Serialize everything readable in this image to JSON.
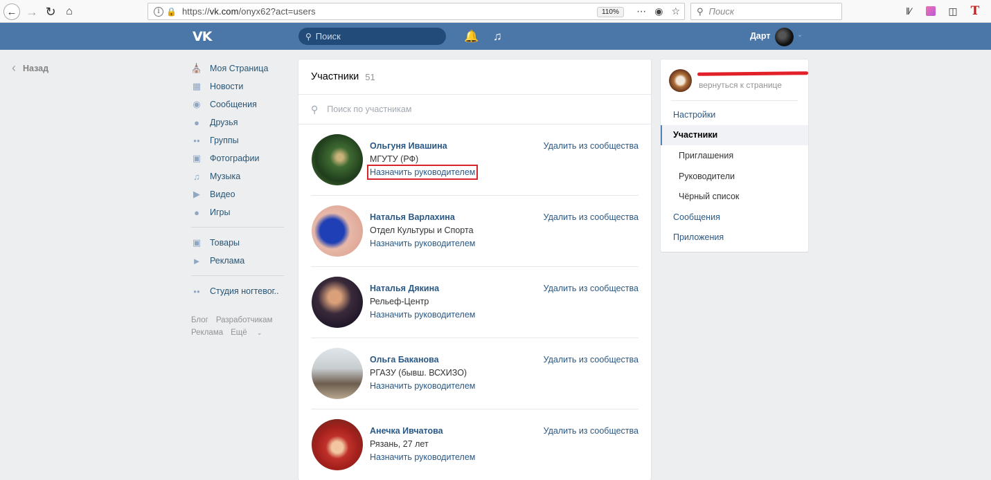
{
  "browser": {
    "url_prefix": "https://",
    "url_host": "vk.com",
    "url_path": "/onyx62?act=users",
    "zoom": "110%",
    "search_placeholder": "Поиск"
  },
  "header": {
    "search_placeholder": "Поиск",
    "user_name": "Дарт"
  },
  "back": {
    "label": "Назад"
  },
  "left_menu": {
    "items": [
      {
        "label": "Моя Страница",
        "icon": "home-icon"
      },
      {
        "label": "Новости",
        "icon": "news-icon"
      },
      {
        "label": "Сообщения",
        "icon": "messages-icon"
      },
      {
        "label": "Друзья",
        "icon": "friends-icon"
      },
      {
        "label": "Группы",
        "icon": "groups-icon"
      },
      {
        "label": "Фотографии",
        "icon": "photos-icon"
      },
      {
        "label": "Музыка",
        "icon": "music-icon"
      },
      {
        "label": "Видео",
        "icon": "video-icon"
      },
      {
        "label": "Игры",
        "icon": "games-icon"
      }
    ],
    "items2": [
      {
        "label": "Товары",
        "icon": "goods-icon"
      },
      {
        "label": "Реклама",
        "icon": "ads-icon"
      }
    ],
    "items3": [
      {
        "label": "Студия ногтевог..",
        "icon": "community-icon"
      }
    ],
    "footer": {
      "blog": "Блог",
      "dev": "Разработчикам",
      "ads": "Реклама",
      "more": "Ещё"
    }
  },
  "main": {
    "title": "Участники",
    "count": "51",
    "search_placeholder": "Поиск по участникам",
    "members": [
      {
        "name": "Ольгуня Ивашина",
        "info": "МГУТУ (РФ)",
        "promote": "Назначить руководителем",
        "remove": "Удалить из сообщества"
      },
      {
        "name": "Наталья Варлахина",
        "info": "Отдел Культуры и Спорта",
        "promote": "Назначить руководителем",
        "remove": "Удалить из сообщества"
      },
      {
        "name": "Наталья Дякина",
        "info": "Рельеф-Центр",
        "promote": "Назначить руководителем",
        "remove": "Удалить из сообщества"
      },
      {
        "name": "Ольга Баканова",
        "info": "РГАЗУ (бывш. ВСХИЗО)",
        "promote": "Назначить руководителем",
        "remove": "Удалить из сообщества"
      },
      {
        "name": "Анечка Ивчатова",
        "info": "Рязань, 27 лет",
        "promote": "Назначить руководителем",
        "remove": "Удалить из сообщества"
      }
    ]
  },
  "right_menu": {
    "back_link": "вернуться к странице",
    "items": [
      {
        "label": "Настройки"
      },
      {
        "label": "Участники"
      },
      {
        "label": "Приглашения"
      },
      {
        "label": "Руководители"
      },
      {
        "label": "Чёрный список"
      },
      {
        "label": "Сообщения"
      },
      {
        "label": "Приложения"
      }
    ]
  },
  "colors": {
    "vk_header": "#4a76a8",
    "link": "#2a5885",
    "highlight_box": "#d8232a"
  }
}
